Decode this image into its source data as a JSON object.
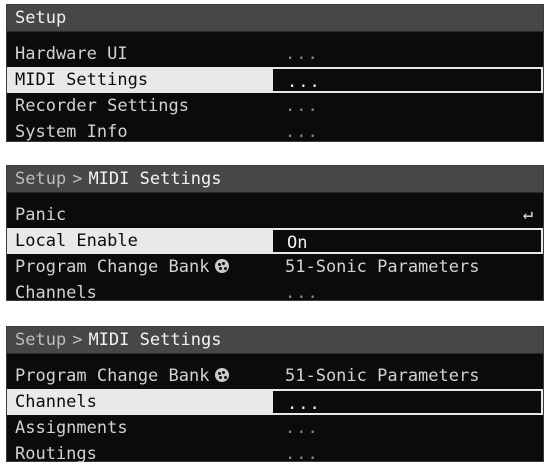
{
  "screen1": {
    "title": "Setup",
    "rows": [
      {
        "label": "Hardware UI",
        "value": "..."
      },
      {
        "label": "MIDI Settings",
        "value": "..."
      },
      {
        "label": "Recorder Settings",
        "value": "..."
      },
      {
        "label": "System Info",
        "value": "..."
      }
    ]
  },
  "screen2": {
    "breadcrumb_parent": "Setup",
    "breadcrumb_sep": ">",
    "breadcrumb_current": "MIDI Settings",
    "rows": [
      {
        "label": "Panic",
        "value": ""
      },
      {
        "label": "Local Enable",
        "value": "On"
      },
      {
        "label": "Program Change Bank",
        "value": "51-Sonic Parameters"
      },
      {
        "label": "Channels",
        "value": "..."
      }
    ],
    "enter_icon": "enter-icon"
  },
  "screen3": {
    "breadcrumb_parent": "Setup",
    "breadcrumb_sep": ">",
    "breadcrumb_current": "MIDI Settings",
    "rows": [
      {
        "label": "Program Change Bank",
        "value": "51-Sonic Parameters"
      },
      {
        "label": "Channels",
        "value": "..."
      },
      {
        "label": "Assignments",
        "value": "..."
      },
      {
        "label": "Routings",
        "value": "..."
      }
    ]
  },
  "icons": {
    "knob": "knob-icon",
    "enter": "enter-icon"
  },
  "colors": {
    "header_bg": "#474747",
    "panel_bg": "#0b0b0b",
    "selection": "#e9e9e9"
  }
}
